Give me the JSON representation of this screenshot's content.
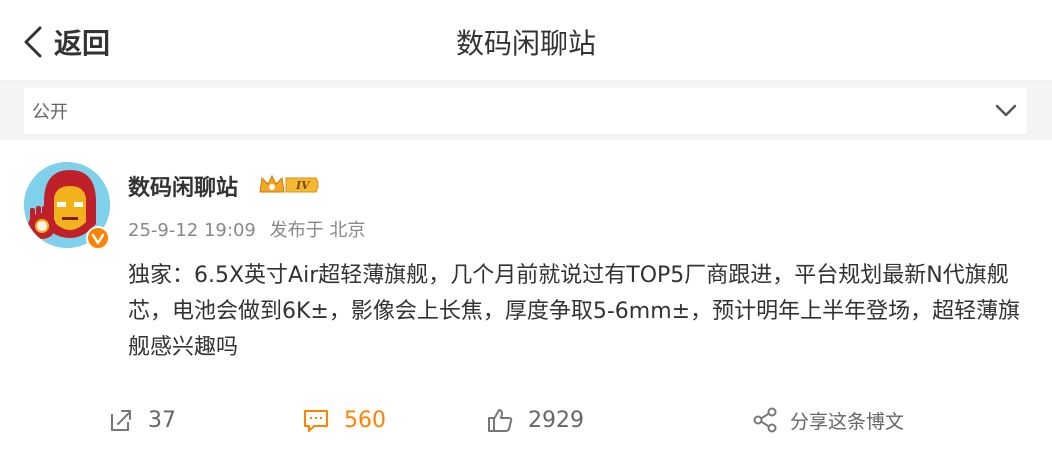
{
  "header": {
    "back_label": "返回",
    "title": "数码闲聊站"
  },
  "visibility": {
    "label": "公开"
  },
  "post": {
    "author": "数码闲聊站",
    "level_badge": "IV",
    "date": "25-9-12 19:09",
    "source": "发布于 北京",
    "text": "独家：6.5X英寸Air超轻薄旗舰，几个月前就说过有TOP5厂商跟进，平台规划最新N代旗舰芯，电池会做到6K±，影像会上长焦，厚度争取5-6mm±，预计明年上半年登场，超轻薄旗舰感兴趣吗"
  },
  "actions": {
    "repost_count": "37",
    "comment_count": "560",
    "like_count": "2929",
    "share_label": "分享这条博文"
  },
  "colors": {
    "accent_orange": "#ff8200",
    "text_dark": "#333333",
    "text_gray": "#888888"
  }
}
